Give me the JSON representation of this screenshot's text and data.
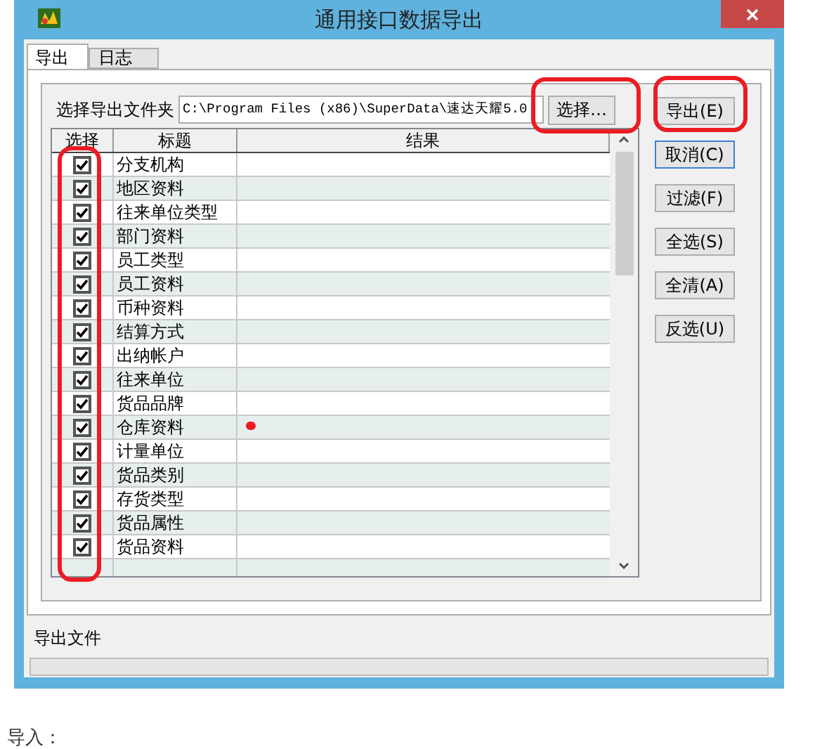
{
  "window": {
    "title": "通用接口数据导出"
  },
  "tabs": [
    {
      "label": "导出",
      "selected": true
    },
    {
      "label": "日志",
      "selected": false
    }
  ],
  "folder": {
    "label": "选择导出文件夹",
    "value": "C:\\Program Files (x86)\\SuperData\\速达天耀5.0",
    "browse_button": "选择…"
  },
  "table": {
    "columns": [
      "选择",
      "标题",
      "结果"
    ],
    "rows": [
      {
        "checked": true,
        "title": "分支机构"
      },
      {
        "checked": true,
        "title": "地区资料"
      },
      {
        "checked": true,
        "title": "往来单位类型"
      },
      {
        "checked": true,
        "title": "部门资料"
      },
      {
        "checked": true,
        "title": "员工类型"
      },
      {
        "checked": true,
        "title": "员工资料"
      },
      {
        "checked": true,
        "title": "币种资料"
      },
      {
        "checked": true,
        "title": "结算方式"
      },
      {
        "checked": true,
        "title": "出纳帐户"
      },
      {
        "checked": true,
        "title": "往来单位"
      },
      {
        "checked": true,
        "title": "货品品牌"
      },
      {
        "checked": true,
        "title": "仓库资料"
      },
      {
        "checked": true,
        "title": "计量单位"
      },
      {
        "checked": true,
        "title": "货品类别"
      },
      {
        "checked": true,
        "title": "存货类型"
      },
      {
        "checked": true,
        "title": "货品属性"
      },
      {
        "checked": true,
        "title": "货品资料"
      }
    ]
  },
  "buttons": [
    {
      "label": "导出(E)",
      "focused": false
    },
    {
      "label": "取消(C)",
      "focused": true
    },
    {
      "label": "过滤(F)",
      "focused": false
    },
    {
      "label": "全选(S)",
      "focused": false
    },
    {
      "label": "全清(A)",
      "focused": false
    },
    {
      "label": "反选(U)",
      "focused": false
    }
  ],
  "status_bar": {
    "text": "导出文件",
    "level": 0
  },
  "page_text": "导入："
}
